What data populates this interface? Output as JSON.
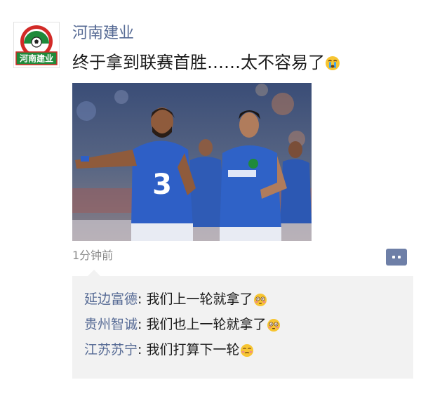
{
  "post": {
    "author": "河南建业",
    "text": "终于拿到联赛首胜……太不容易了",
    "text_emoji": "crying-face-emoji",
    "time": "1分钟前",
    "avatar_logo_text": "河南建业",
    "photo": {
      "jersey_number_left": "3"
    }
  },
  "comments": [
    {
      "name": "延边富德",
      "sep": ": ",
      "text": "我们上一轮就拿了",
      "emoji": "flushed-face-emoji"
    },
    {
      "name": "贵州智诚",
      "sep": ": ",
      "text": "我们也上一轮就拿了",
      "emoji": "flushed-face-emoji"
    },
    {
      "name": "江苏苏宁",
      "sep": ": ",
      "text": "我们打算下一轮",
      "emoji": "grimacing-face-emoji"
    }
  ],
  "icons": {
    "comment_button": "comment-dots-icon"
  },
  "colors": {
    "link": "#576b95",
    "text": "#1a1a1a",
    "timestamp": "#8b8b8b",
    "comment_bg": "#f2f2f2",
    "logo_green": "#1f8a3a",
    "logo_red": "#d22a27"
  }
}
